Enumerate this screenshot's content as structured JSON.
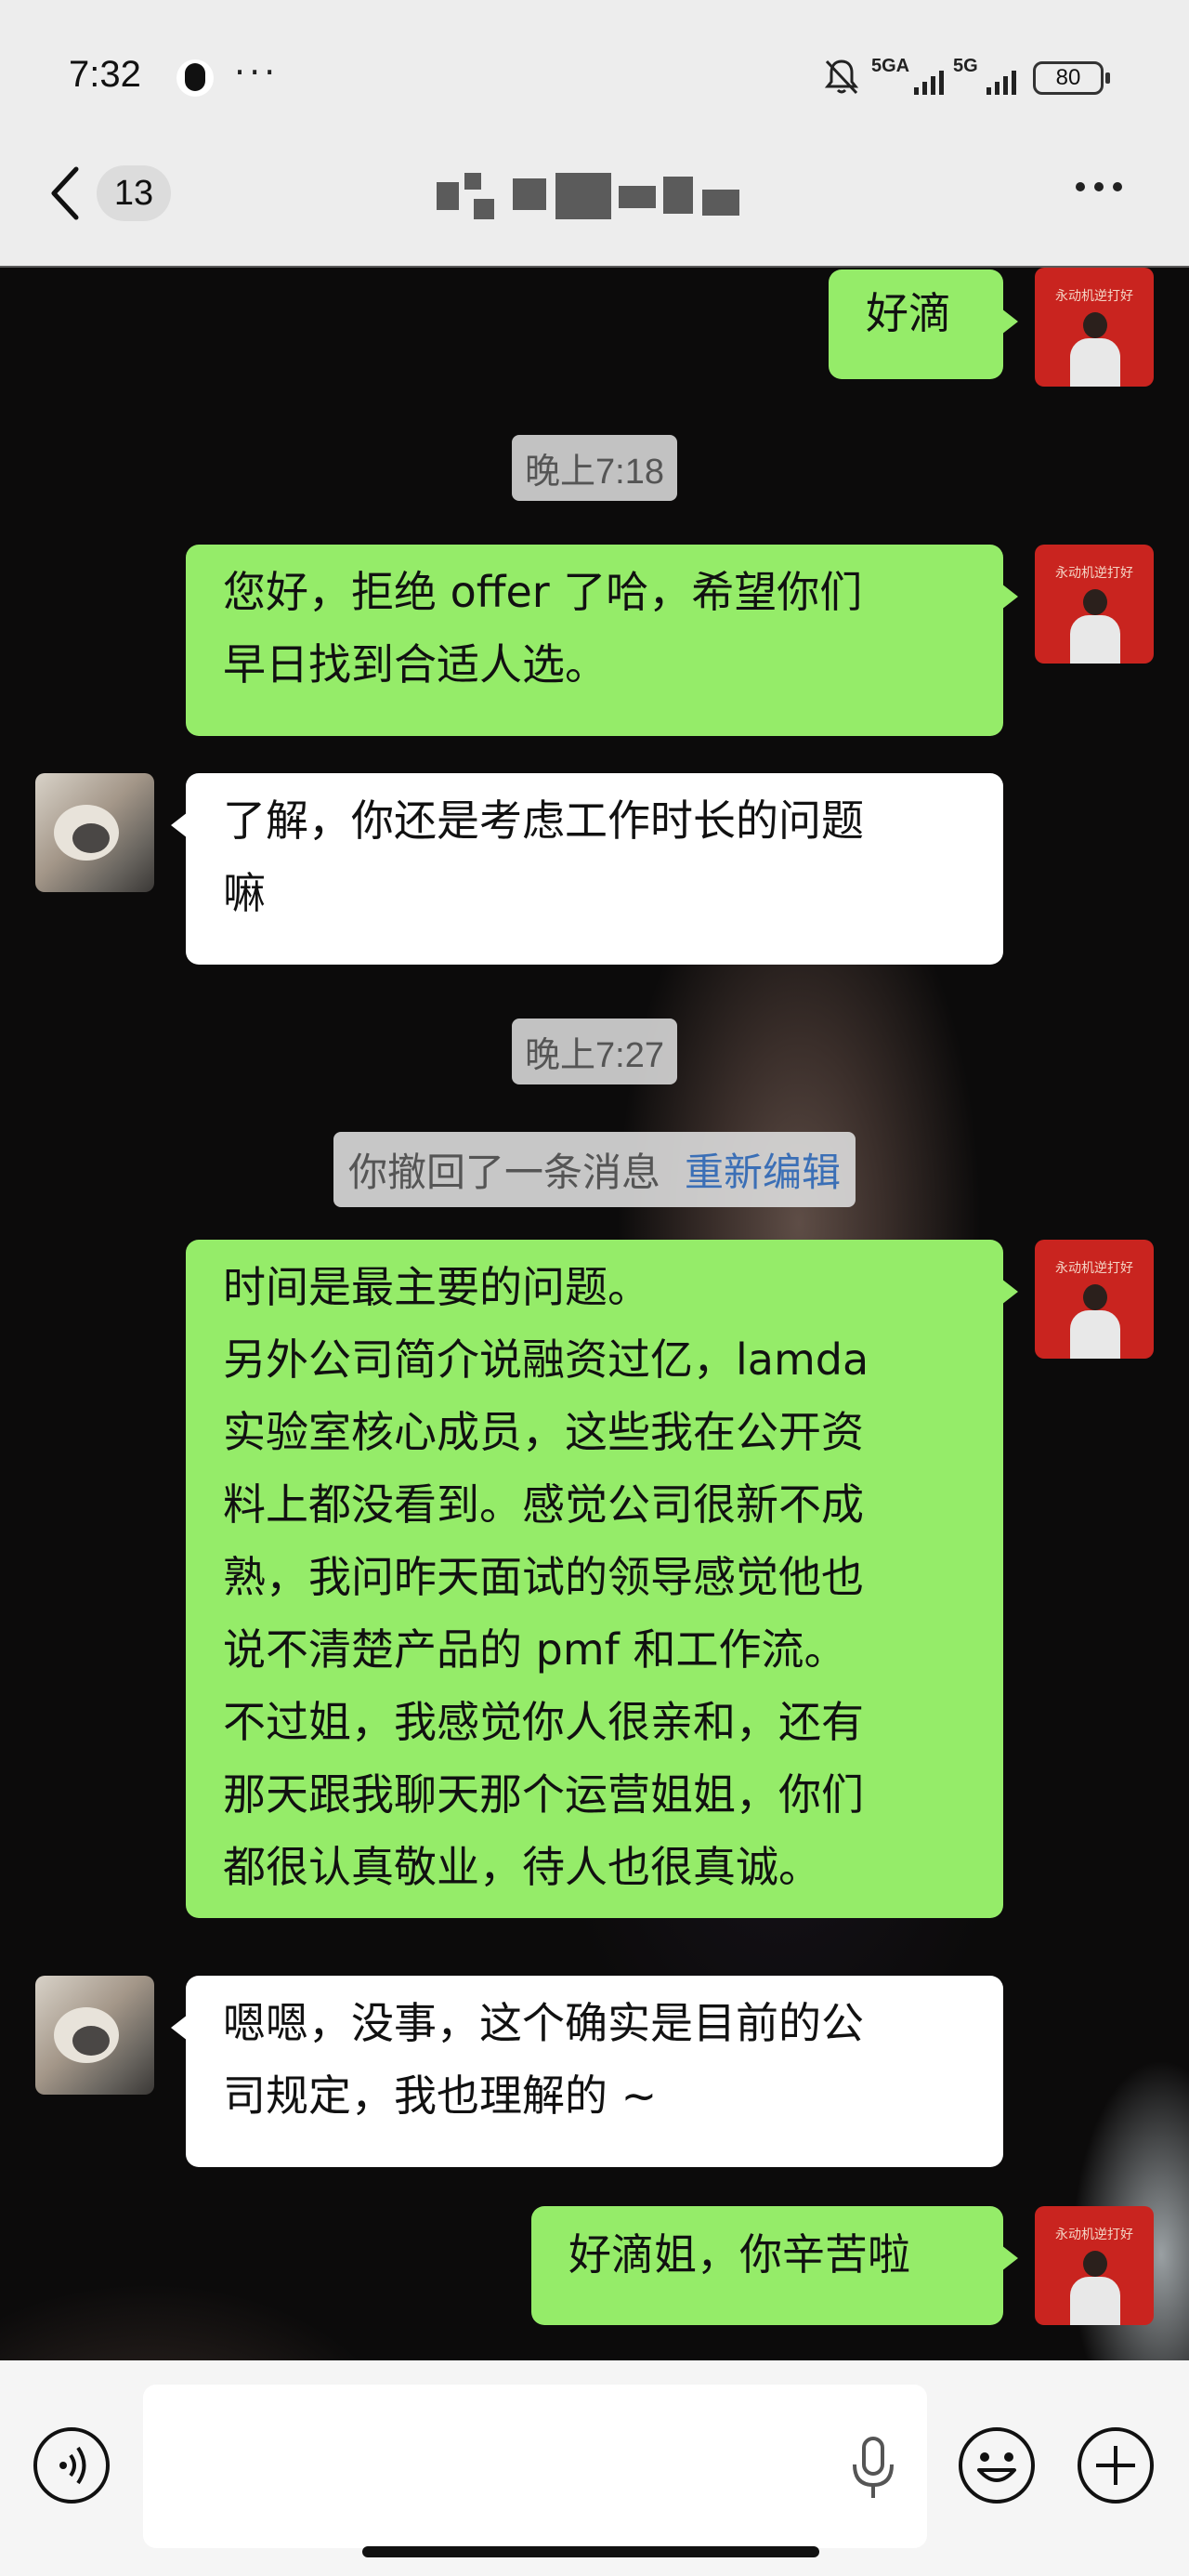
{
  "status_bar": {
    "time": "7:32",
    "more": "···",
    "net1": "5GA",
    "net2": "5G",
    "battery": "80"
  },
  "nav": {
    "back_count": "13",
    "title_obscured": ""
  },
  "messages": [
    {
      "side": "me",
      "text": "好滴"
    },
    {
      "kind": "time",
      "text": "晚上7:18"
    },
    {
      "side": "me",
      "text": "您好，拒绝 offer 了哈，希望你们\n早日找到合适人选。"
    },
    {
      "side": "them",
      "text": "了解，你还是考虑工作时长的问题\n嘛"
    },
    {
      "kind": "time",
      "text": "晚上7:27"
    },
    {
      "kind": "recall",
      "text": "你撤回了一条消息",
      "link": "重新编辑"
    },
    {
      "side": "me",
      "text": "时间是最主要的问题。\n另外公司简介说融资过亿，lamda\n实验室核心成员，这些我在公开资\n料上都没看到。感觉公司很新不成\n熟，我问昨天面试的领导感觉他也\n说不清楚产品的 pmf 和工作流。\n不过姐，我感觉你人很亲和，还有\n那天跟我聊天那个运营姐姐，你们\n都很认真敬业，待人也很真诚。"
    },
    {
      "side": "them",
      "text": "嗯嗯，没事，这个确实是目前的公\n司规定，我也理解的 ~"
    },
    {
      "side": "me",
      "text": "好滴姐，你辛苦啦"
    }
  ],
  "avatar_caption": "永动机逆打好",
  "input": {
    "placeholder": ""
  },
  "icons": [
    "voice-icon",
    "mic-icon",
    "emoji-icon",
    "plus-icon",
    "back-chevron-icon",
    "more-icon",
    "mute-icon"
  ]
}
